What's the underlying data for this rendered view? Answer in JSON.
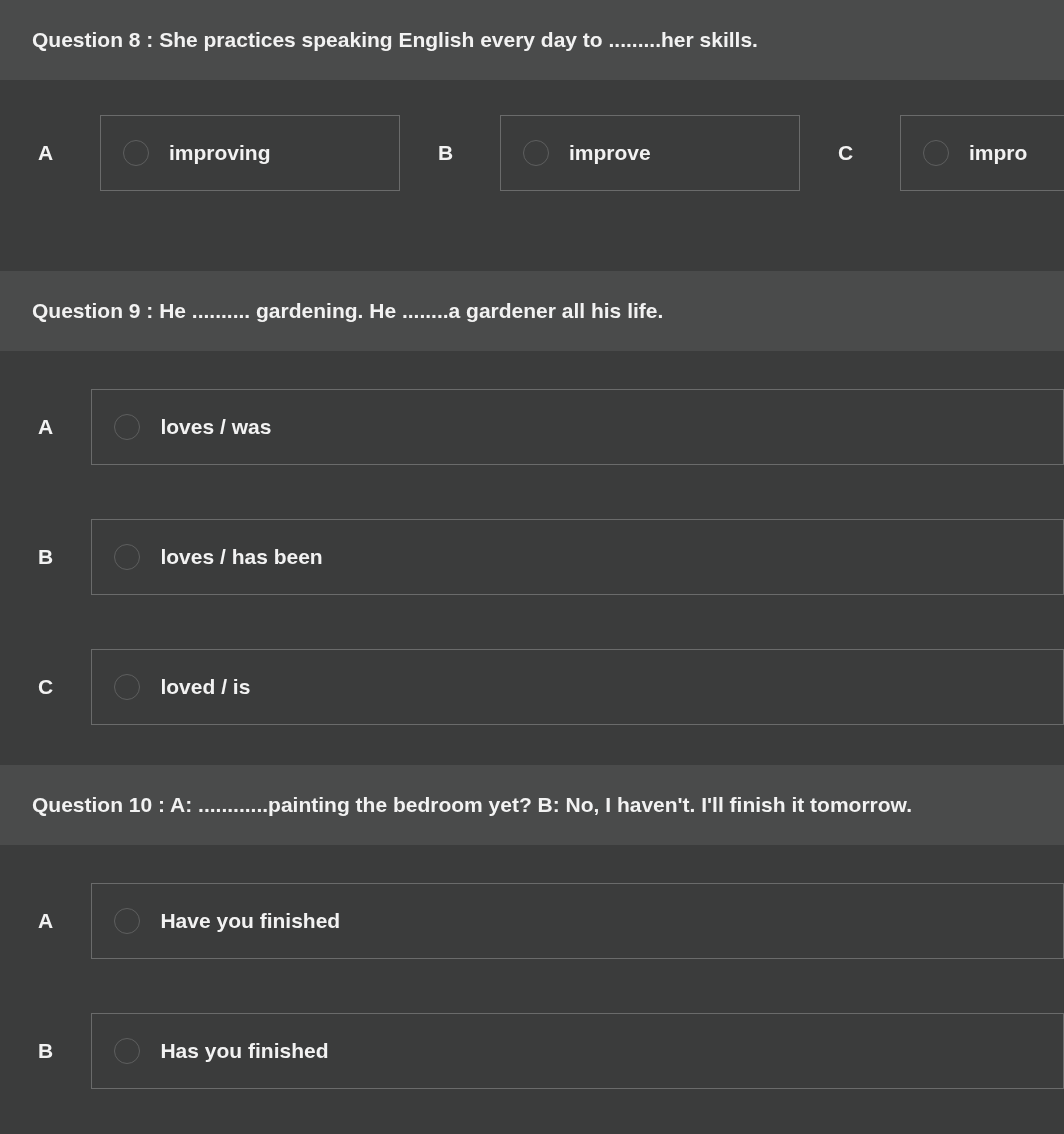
{
  "questions": [
    {
      "label": "Question 8 :",
      "text": "She practices speaking English every day to .........her skills.",
      "kind": "row",
      "options": [
        {
          "letter": "A",
          "text": "improving",
          "selected": false
        },
        {
          "letter": "B",
          "text": "improve",
          "selected": false
        },
        {
          "letter": "C",
          "text": "impro",
          "selected": false
        }
      ]
    },
    {
      "label": "Question 9 :",
      "text": "He .......... gardening. He ........a gardener all his life.",
      "kind": "column",
      "options": [
        {
          "letter": "A",
          "text": "loves / was",
          "selected": false
        },
        {
          "letter": "B",
          "text": "loves / has been",
          "selected": false
        },
        {
          "letter": "C",
          "text": "loved / is",
          "selected": false
        }
      ]
    },
    {
      "label": "Question 10 :",
      "text": "A: ............painting the bedroom yet? B: No, I haven't. I'll finish it tomorrow.",
      "kind": "column",
      "options": [
        {
          "letter": "A",
          "text": "Have you finished",
          "selected": false
        },
        {
          "letter": "B",
          "text": "Has you finished",
          "selected": false
        }
      ]
    }
  ]
}
